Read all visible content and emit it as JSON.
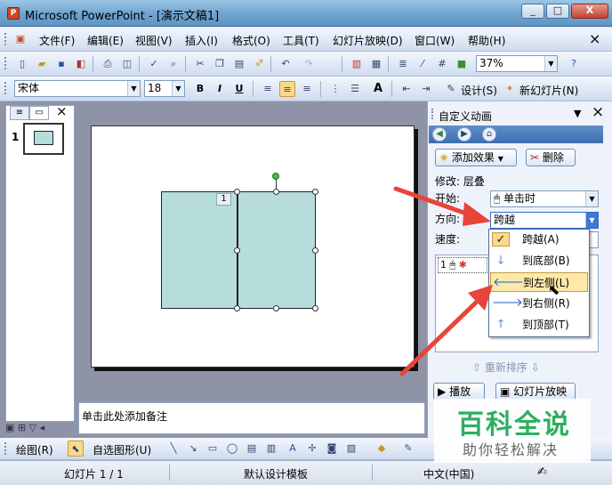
{
  "window": {
    "title": "Microsoft PowerPoint - [演示文稿1]",
    "min": "_",
    "max": "□",
    "close": "X"
  },
  "menu": {
    "items": [
      "文件(F)",
      "编辑(E)",
      "视图(V)",
      "插入(I)",
      "格式(O)",
      "工具(T)",
      "幻灯片放映(D)",
      "窗口(W)",
      "帮助(H)"
    ],
    "close": "×"
  },
  "toolbar": {
    "zoom": "37%"
  },
  "format_bar": {
    "font": "宋体",
    "size": "18",
    "bold": "B",
    "italic": "I",
    "underline": "U",
    "font_grow": "A",
    "design": "设计(S)",
    "new_slide": "新幻灯片(N)"
  },
  "slides_pane": {
    "slide_number": "1",
    "close": "×"
  },
  "slide": {
    "anim_tag": "1"
  },
  "notes": {
    "placeholder": "单击此处添加备注"
  },
  "task_pane": {
    "title": "自定义动画",
    "add_effect": "添加效果",
    "delete": "删除",
    "modify": "修改: 层叠",
    "start_label": "开始:",
    "start_value": "单击时",
    "direction_label": "方向:",
    "direction_value": "跨越",
    "speed_label": "速度:",
    "list_item_number": "1",
    "reorder": "重新排序",
    "play": "播放",
    "slideshow": "幻灯片放映"
  },
  "direction_options": [
    {
      "label": "跨越(A)",
      "icon": "checkmark-icon",
      "checked": true
    },
    {
      "label": "到底部(B)",
      "icon": "arrow-down-icon"
    },
    {
      "label": "到左侧(L)",
      "icon": "arrow-left-icon",
      "highlighted": true
    },
    {
      "label": "到右侧(R)",
      "icon": "arrow-right-icon"
    },
    {
      "label": "到顶部(T)",
      "icon": "arrow-up-icon"
    }
  ],
  "draw_bar": {
    "draw": "绘图(R)",
    "autoshapes": "自选图形(U)"
  },
  "status": {
    "slide": "幻灯片 1 / 1",
    "template": "默认设计模板",
    "language": "中文(中国)"
  },
  "watermark": {
    "line1": "百科全说",
    "line2": "助你轻松解决"
  },
  "colors": {
    "annotation_arrow": "#e8443a",
    "shape_fill": "#b6dcdc",
    "highlight": "#fde9a8"
  }
}
